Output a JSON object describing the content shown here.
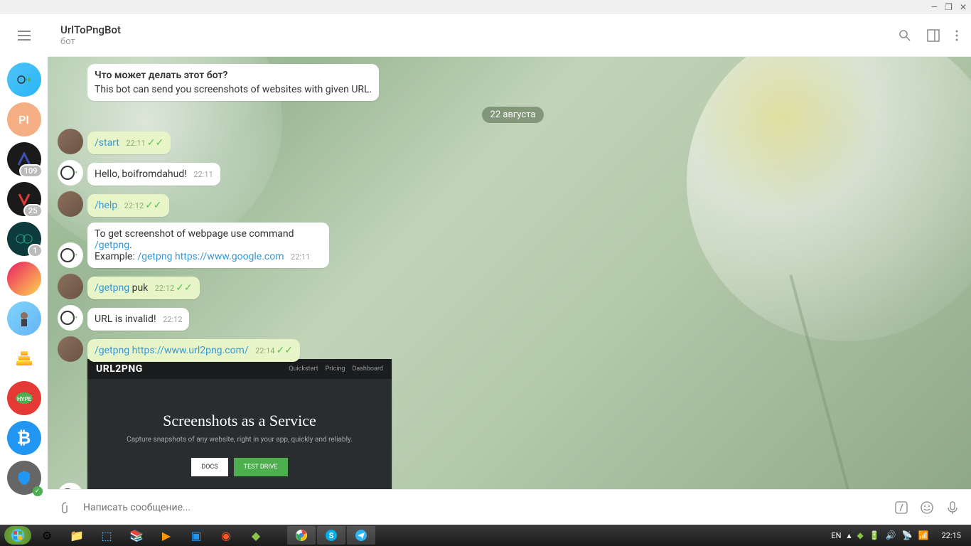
{
  "titlebar": {
    "minimize": "—",
    "maximize": "❐",
    "close": "✕"
  },
  "header": {
    "title": "UrlToPngBot",
    "subtitle": "бот"
  },
  "sidebar": {
    "items": [
      {
        "badge": ""
      },
      {
        "label": "PI"
      },
      {
        "badge": "109"
      },
      {
        "badge": "25"
      },
      {
        "badge": "1"
      },
      {
        "badge": ""
      },
      {
        "badge": ""
      },
      {
        "badge": ""
      },
      {
        "badge": ""
      },
      {
        "badge": ""
      },
      {
        "badge": ""
      }
    ]
  },
  "intro": {
    "question": "Что может делать этот бот?",
    "desc": "This bot can send you screenshots of websites with given URL."
  },
  "date": "22 августа",
  "messages": [
    {
      "type": "out",
      "cmd": "/start",
      "text": "",
      "time": "22:11"
    },
    {
      "type": "in",
      "text": "Hello, boifromdahud!",
      "time": "22:11"
    },
    {
      "type": "out",
      "cmd": "/help",
      "text": "",
      "time": "22:12"
    },
    {
      "type": "in",
      "pre": "To get screenshot of webpage use command ",
      "cmd1": "/getpng",
      "mid": ".\nExample: ",
      "cmd2": "/getpng",
      "post": " https://www.google.com",
      "time": "22:11"
    },
    {
      "type": "out",
      "cmd": "/getpng",
      "text": " puk",
      "time": "22:12"
    },
    {
      "type": "in",
      "text": "URL is invalid!",
      "time": "22:12"
    },
    {
      "type": "out",
      "cmd": "/getpng",
      "text": " https://www.url2png.com/",
      "time": "22:14"
    }
  ],
  "screenshot": {
    "logo": "URL2PNG",
    "nav": [
      "Quickstart",
      "Pricing",
      "Dashboard"
    ],
    "heading": "Screenshots as a Service",
    "sub": "Capture snapshots of any website, right in your app, quickly and reliably.",
    "btn1": "DOCS",
    "btn2": "TEST DRIVE"
  },
  "input": {
    "placeholder": "Написать сообщение..."
  },
  "taskbar": {
    "lang": "EN",
    "time": "22:15"
  }
}
